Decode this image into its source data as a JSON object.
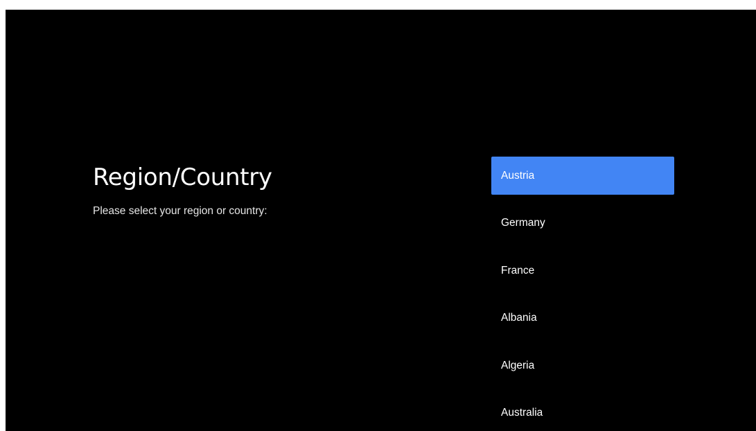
{
  "screen": {
    "title": "Region/Country",
    "subtitle": "Please select your region or country:"
  },
  "countries": {
    "selected_index": 0,
    "items": [
      {
        "label": "Austria"
      },
      {
        "label": "Germany"
      },
      {
        "label": "France"
      },
      {
        "label": "Albania"
      },
      {
        "label": "Algeria"
      },
      {
        "label": "Australia"
      }
    ]
  },
  "colors": {
    "background": "#000000",
    "highlight": "#4285f4",
    "text": "#ffffff"
  }
}
